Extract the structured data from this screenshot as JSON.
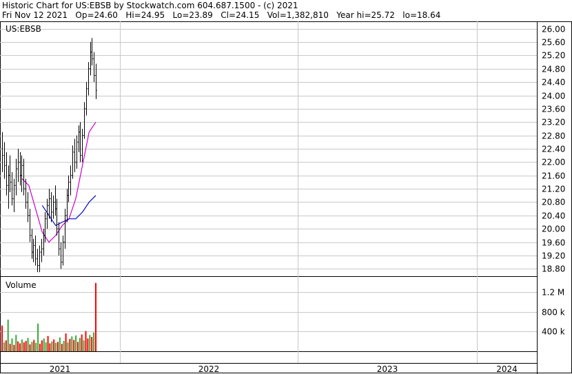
{
  "header": {
    "line1": "Historic Chart for US:EBSB by Stockwatch.com 604.687.1500 - (c) 2021",
    "line2": "Fri Nov 12 2021   Op=24.60   Hi=24.95   Lo=23.89   Cl=24.15   Vol=1,382,810   Year hi=25.72   lo=18.64"
  },
  "chart_data": [
    {
      "type": "candlestick",
      "symbol_label": "US:EBSB",
      "ylim": [
        18.6,
        26.2
      ],
      "y_ticks": [
        "26.00",
        "25.60",
        "25.20",
        "24.80",
        "24.40",
        "24.00",
        "23.60",
        "23.20",
        "22.80",
        "22.40",
        "22.00",
        "21.60",
        "21.20",
        "20.80",
        "20.40",
        "20.00",
        "19.60",
        "19.20",
        "18.80"
      ],
      "x_labels": [
        "2021",
        "2022",
        "2023",
        "2024"
      ],
      "ohlc": [
        {
          "o": 22.4,
          "h": 22.9,
          "l": 21.7,
          "c": 22.2
        },
        {
          "o": 22.2,
          "h": 22.6,
          "l": 21.5,
          "c": 21.9
        },
        {
          "o": 21.9,
          "h": 22.3,
          "l": 21.0,
          "c": 21.3
        },
        {
          "o": 21.3,
          "h": 21.9,
          "l": 20.6,
          "c": 21.6
        },
        {
          "o": 21.6,
          "h": 22.2,
          "l": 21.1,
          "c": 21.4
        },
        {
          "o": 21.4,
          "h": 21.7,
          "l": 20.7,
          "c": 20.9
        },
        {
          "o": 20.9,
          "h": 21.5,
          "l": 20.5,
          "c": 21.3
        },
        {
          "o": 21.3,
          "h": 22.1,
          "l": 21.0,
          "c": 21.8
        },
        {
          "o": 21.8,
          "h": 22.4,
          "l": 21.4,
          "c": 22.0
        },
        {
          "o": 22.0,
          "h": 22.3,
          "l": 21.3,
          "c": 21.6
        },
        {
          "o": 21.6,
          "h": 22.2,
          "l": 21.1,
          "c": 21.9
        },
        {
          "o": 21.9,
          "h": 22.1,
          "l": 21.0,
          "c": 21.2
        },
        {
          "o": 21.2,
          "h": 21.5,
          "l": 20.6,
          "c": 20.8
        },
        {
          "o": 20.8,
          "h": 21.1,
          "l": 20.2,
          "c": 20.4
        },
        {
          "o": 20.4,
          "h": 20.6,
          "l": 19.6,
          "c": 19.8
        },
        {
          "o": 19.8,
          "h": 20.0,
          "l": 19.1,
          "c": 19.3
        },
        {
          "o": 19.3,
          "h": 19.7,
          "l": 19.0,
          "c": 19.5
        },
        {
          "o": 19.5,
          "h": 19.8,
          "l": 18.9,
          "c": 19.1
        },
        {
          "o": 19.1,
          "h": 19.4,
          "l": 18.7,
          "c": 18.9
        },
        {
          "o": 18.9,
          "h": 19.5,
          "l": 18.7,
          "c": 19.3
        },
        {
          "o": 19.3,
          "h": 19.7,
          "l": 19.0,
          "c": 19.4
        },
        {
          "o": 19.4,
          "h": 20.0,
          "l": 19.2,
          "c": 19.8
        },
        {
          "o": 19.8,
          "h": 20.5,
          "l": 19.6,
          "c": 20.3
        },
        {
          "o": 20.3,
          "h": 20.9,
          "l": 20.0,
          "c": 20.7
        },
        {
          "o": 20.7,
          "h": 21.2,
          "l": 20.3,
          "c": 20.9
        },
        {
          "o": 20.9,
          "h": 21.1,
          "l": 20.2,
          "c": 20.5
        },
        {
          "o": 20.5,
          "h": 21.0,
          "l": 20.3,
          "c": 20.8
        },
        {
          "o": 20.8,
          "h": 21.3,
          "l": 20.4,
          "c": 20.6
        },
        {
          "o": 20.6,
          "h": 20.9,
          "l": 19.8,
          "c": 20.0
        },
        {
          "o": 20.0,
          "h": 20.2,
          "l": 19.2,
          "c": 19.4
        },
        {
          "o": 19.4,
          "h": 19.6,
          "l": 18.8,
          "c": 19.0
        },
        {
          "o": 19.0,
          "h": 19.8,
          "l": 18.9,
          "c": 19.6
        },
        {
          "o": 19.6,
          "h": 20.6,
          "l": 19.4,
          "c": 20.4
        },
        {
          "o": 20.4,
          "h": 21.2,
          "l": 20.2,
          "c": 21.0
        },
        {
          "o": 21.0,
          "h": 21.6,
          "l": 20.8,
          "c": 21.4
        },
        {
          "o": 21.4,
          "h": 21.9,
          "l": 21.0,
          "c": 21.6
        },
        {
          "o": 21.6,
          "h": 22.5,
          "l": 21.5,
          "c": 22.3
        },
        {
          "o": 22.3,
          "h": 22.7,
          "l": 21.7,
          "c": 22.0
        },
        {
          "o": 22.0,
          "h": 22.8,
          "l": 21.8,
          "c": 22.6
        },
        {
          "o": 22.6,
          "h": 23.1,
          "l": 22.3,
          "c": 22.9
        },
        {
          "o": 22.9,
          "h": 23.2,
          "l": 22.0,
          "c": 22.2
        },
        {
          "o": 22.2,
          "h": 23.0,
          "l": 22.0,
          "c": 22.8
        },
        {
          "o": 22.8,
          "h": 23.8,
          "l": 22.7,
          "c": 23.6
        },
        {
          "o": 23.6,
          "h": 24.4,
          "l": 23.4,
          "c": 24.2
        },
        {
          "o": 24.2,
          "h": 25.0,
          "l": 24.0,
          "c": 24.8
        },
        {
          "o": 24.8,
          "h": 25.6,
          "l": 24.6,
          "c": 25.3
        },
        {
          "o": 25.3,
          "h": 25.72,
          "l": 24.9,
          "c": 25.1
        },
        {
          "o": 25.1,
          "h": 25.3,
          "l": 24.4,
          "c": 24.6
        },
        {
          "o": 24.6,
          "h": 24.95,
          "l": 23.89,
          "c": 24.15
        }
      ],
      "moving_averages": [
        {
          "color": "#cc00cc",
          "points": [
            [
              15,
              21.5
            ],
            [
              20,
              21.3
            ],
            [
              25,
              20.6
            ],
            [
              30,
              19.9
            ],
            [
              35,
              19.6
            ],
            [
              40,
              19.8
            ],
            [
              45,
              20.1
            ],
            [
              50,
              20.3
            ],
            [
              55,
              20.9
            ],
            [
              60,
              21.9
            ],
            [
              65,
              22.9
            ],
            [
              70,
              23.2
            ]
          ]
        },
        {
          "color": "#0000cc",
          "points": [
            [
              30,
              20.7
            ],
            [
              35,
              20.4
            ],
            [
              40,
              20.1
            ],
            [
              45,
              20.2
            ],
            [
              50,
              20.3
            ],
            [
              55,
              20.3
            ],
            [
              60,
              20.5
            ],
            [
              65,
              20.8
            ],
            [
              70,
              21.0
            ]
          ]
        }
      ]
    },
    {
      "type": "bar",
      "title": "Volume",
      "ylim": [
        0,
        1450000
      ],
      "y_ticks": [
        {
          "label": "1.2 M",
          "value": 1200000
        },
        {
          "label": "800 k",
          "value": 800000
        },
        {
          "label": "400 k",
          "value": 400000
        }
      ],
      "values": [
        [
          520000,
          "red"
        ],
        [
          180000,
          "green"
        ],
        [
          220000,
          "red"
        ],
        [
          640000,
          "green"
        ],
        [
          150000,
          "red"
        ],
        [
          260000,
          "green"
        ],
        [
          130000,
          "red"
        ],
        [
          330000,
          "green"
        ],
        [
          200000,
          "red"
        ],
        [
          160000,
          "red"
        ],
        [
          240000,
          "green"
        ],
        [
          180000,
          "red"
        ],
        [
          210000,
          "red"
        ],
        [
          270000,
          "green"
        ],
        [
          140000,
          "red"
        ],
        [
          190000,
          "green"
        ],
        [
          230000,
          "red"
        ],
        [
          170000,
          "green"
        ],
        [
          560000,
          "green"
        ],
        [
          150000,
          "red"
        ],
        [
          220000,
          "red"
        ],
        [
          260000,
          "green"
        ],
        [
          180000,
          "green"
        ],
        [
          310000,
          "red"
        ],
        [
          160000,
          "red"
        ],
        [
          200000,
          "green"
        ],
        [
          240000,
          "red"
        ],
        [
          170000,
          "green"
        ],
        [
          190000,
          "red"
        ],
        [
          280000,
          "green"
        ],
        [
          150000,
          "red"
        ],
        [
          210000,
          "green"
        ],
        [
          360000,
          "red"
        ],
        [
          180000,
          "green"
        ],
        [
          250000,
          "red"
        ],
        [
          300000,
          "green"
        ],
        [
          230000,
          "red"
        ],
        [
          320000,
          "green"
        ],
        [
          190000,
          "red"
        ],
        [
          270000,
          "green"
        ],
        [
          340000,
          "red"
        ],
        [
          220000,
          "green"
        ],
        [
          410000,
          "red"
        ],
        [
          260000,
          "red"
        ],
        [
          330000,
          "green"
        ],
        [
          290000,
          "red"
        ],
        [
          380000,
          "green"
        ],
        [
          1382810,
          "red"
        ]
      ]
    }
  ],
  "colors": {
    "up": "#000000",
    "grid": "#c8c8c8",
    "vol_red": "#ff0000",
    "vol_green": "#33aa33"
  }
}
